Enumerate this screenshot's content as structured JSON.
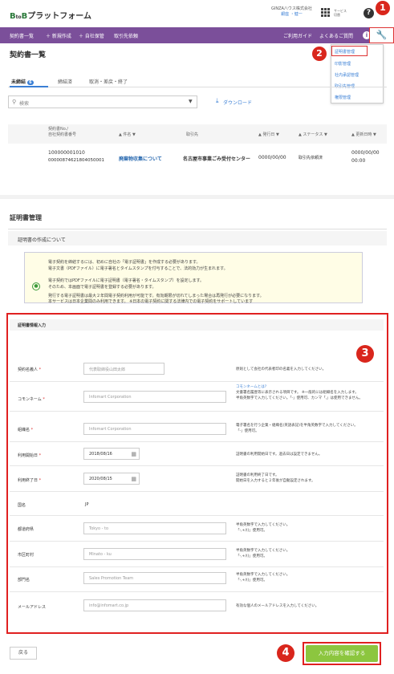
{
  "app": {
    "logo_prefix": "B",
    "logo_sub": "to",
    "logo_suffix": "B",
    "logo_text": "プラットフォーム"
  },
  "user": {
    "company": "GINZA八ウス株式会社",
    "name": "銀座 ・健一"
  },
  "header": {
    "service_label": "サービス\n切替"
  },
  "nav": {
    "items": [
      "契約書一覧",
      "＋ 新規作成",
      "＋ 自社保管",
      "取引先依頼"
    ],
    "guide": "ご利用ガイド",
    "faq": "よくあるご質問",
    "info_icon": "i"
  },
  "dropdown": {
    "items": [
      "証明書管理",
      "印影管理",
      "社内承認管理",
      "取引先管理",
      "権限管理"
    ]
  },
  "callouts": {
    "one": "1",
    "two": "2",
    "three": "3",
    "four": "4"
  },
  "list": {
    "title": "契約書一覧",
    "tabs": [
      "未締結",
      "締結済",
      "取消・差戻・終了"
    ],
    "unsigned_count": "6",
    "search_placeholder": "検索",
    "download": "ダウンロード",
    "headers": {
      "no": "契約書No./\n自社契約書番号",
      "title": "▲ 件名 ▼",
      "partner": "取引先",
      "date": "▲ 発行日 ▼",
      "status": "▲ ステータス ▼",
      "updated": "▲ 更新日時 ▼"
    },
    "row": {
      "no1": "100000001010",
      "no2": "00000874621804050001",
      "title": "廃棄物収集について",
      "partner": "名古屋市事業ごみ受付センター",
      "date": "0000/00/00",
      "status": "取引先依頼済",
      "updated1": "0000/00/00",
      "updated2": "00:00"
    }
  },
  "cert": {
    "title": "証明書管理",
    "about_title": "証明書の作成について",
    "notice_lines": [
      "電子契約を締結するには、初めに自社の「電子証明書」を作成する必要があります。",
      "電子文書（PDFファイル）に電子署名とタイムスタンプを付与することで、法的効力が生まれます。",
      "電子契約ではPDFファイルに電子証明書（電子署名・タイムスタンプ）を設定します。",
      "そのため、本画面で電子証明書を登録する必要があります。",
      "発行する電子証明書は最大２年間電子契約利用が可能です。有効期限が切れてしまった場合は再発行が必要になります。",
      "本サービスは日本企業間のみ利用できます。 ※日本の電子契約に関する法律内での電子契約をサポートしています"
    ],
    "form_title": "証明書情報入力",
    "fields": {
      "signer": {
        "label": "契約名義人",
        "placeholder": "代表取締役山田太郎",
        "help": "原則として会社の代表者印の名義を入力してください。"
      },
      "common": {
        "label": "コモンネーム",
        "placeholder": "Infomart Corporation",
        "help_link": "コモンネームとは?",
        "help1": "文書署名履歴等に表示される項目です。 ※一般的には組織名を入力します。",
        "help2": "半角英数字で入力してください。「-」使用可、カンマ「,」は使用できません。"
      },
      "org": {
        "label": "組織名",
        "placeholder": "Infomart Corporation",
        "help1": "電子署名を行う企業・組織名(英語表記)を半角英数字で入力してください。",
        "help2": "「-」使用可。"
      },
      "start": {
        "label": "利用開始日",
        "value": "2018/08/16",
        "help": "証明書の利用開始日です。過去日は設定できません。"
      },
      "end": {
        "label": "利用終了日",
        "value": "2020/08/15",
        "help1": "証明書の利用終了日です。",
        "help2": "開始日を入力すると２年後が自動設定されます。"
      },
      "country": {
        "label": "国名",
        "value": "JP"
      },
      "pref": {
        "label": "都道府県",
        "placeholder": "Tokyo - to",
        "help1": "半角英数字で入力してください。",
        "help2": "「-,+/()」使用可。"
      },
      "city": {
        "label": "市区町村",
        "placeholder": "Minato - ku",
        "help1": "半角英数字で入力してください。",
        "help2": "「-,+/()」使用可。"
      },
      "dept": {
        "label": "部門名",
        "placeholder": "Sales Promotion Team",
        "help1": "半角英数字で入力してください。",
        "help2": "「-,+/()」使用可。"
      },
      "email": {
        "label": "メールアドレス",
        "placeholder": "info@infomart.co.jp",
        "help": "有効な個人のメールアドレスを入力してください。"
      }
    },
    "required_mark": "*",
    "back": "戻る",
    "confirm": "入力内容を確認する"
  },
  "colors": {
    "nav": "#7b4f9a",
    "link": "#3a7fd5",
    "confirm": "#8cc63f",
    "callout": "#d9261c"
  }
}
